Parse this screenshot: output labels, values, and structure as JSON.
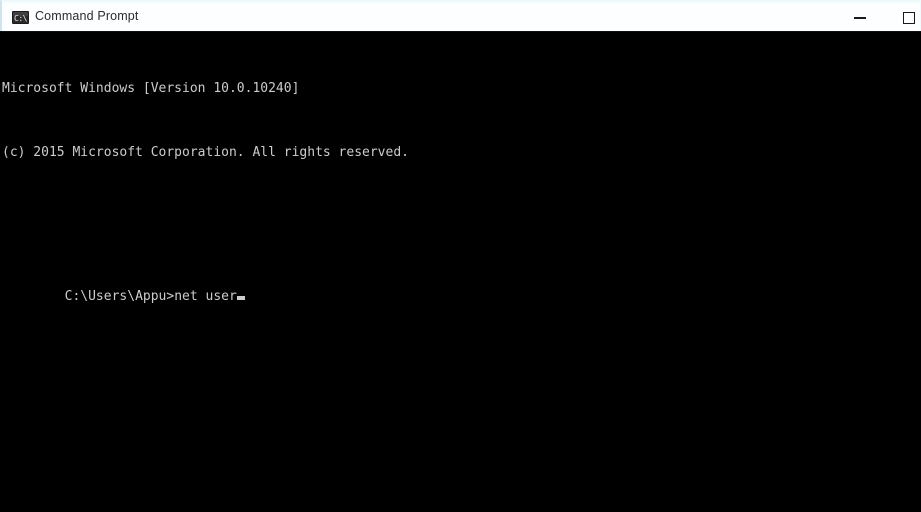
{
  "window": {
    "title": "Command Prompt",
    "icon_name": "cmd-icon",
    "icon_glyph": "C:\\",
    "titlebar_bg": "#fdfeff",
    "titlebar_text_color": "#2c2c2c",
    "titlebar_border_color": "#cfe4ec"
  },
  "controls": {
    "minimize_label": "Minimize",
    "maximize_label": "Maximize"
  },
  "console": {
    "background": "#000000",
    "foreground": "#cccccc",
    "lines": [
      "Microsoft Windows [Version 10.0.10240]",
      "(c) 2015 Microsoft Corporation. All rights reserved.",
      ""
    ],
    "prompt": "C:\\Users\\Appu>",
    "command": "net user",
    "cursor_visible": true
  }
}
